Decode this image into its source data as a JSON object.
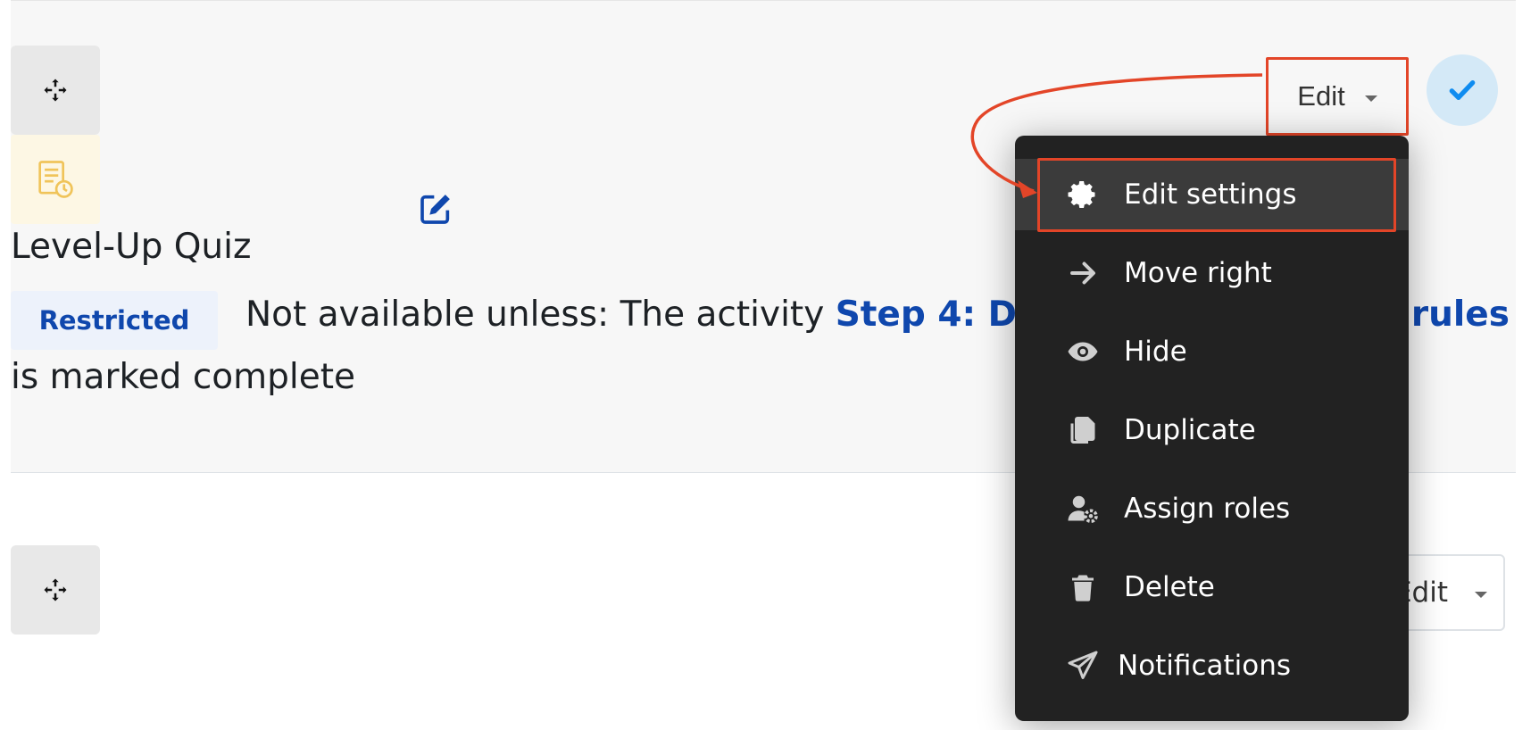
{
  "activity": {
    "title": "Level-Up Quiz",
    "restriction_badge": "Restricted",
    "availability_prefix": "Not available unless: The activity ",
    "availability_link": "Step 4: Develop your project rules",
    "availability_suffix": "is marked complete"
  },
  "edit_menu_toggle": {
    "label": "Edit"
  },
  "second_edit_toggle": {
    "label": "Edit"
  },
  "menu": {
    "items": [
      {
        "label": "Edit settings",
        "icon": "gear-icon"
      },
      {
        "label": "Move right",
        "icon": "arrow-right-icon"
      },
      {
        "label": "Hide",
        "icon": "eye-icon"
      },
      {
        "label": "Duplicate",
        "icon": "copy-icon"
      },
      {
        "label": "Assign roles",
        "icon": "user-gear-icon"
      },
      {
        "label": "Delete",
        "icon": "trash-icon"
      },
      {
        "label": "Notifications",
        "icon": "paper-plane-icon"
      }
    ]
  },
  "colors": {
    "highlight": "#e34528",
    "link": "#0f47ad",
    "menu_bg": "#222222",
    "complete_check": "#0f8cf0"
  }
}
